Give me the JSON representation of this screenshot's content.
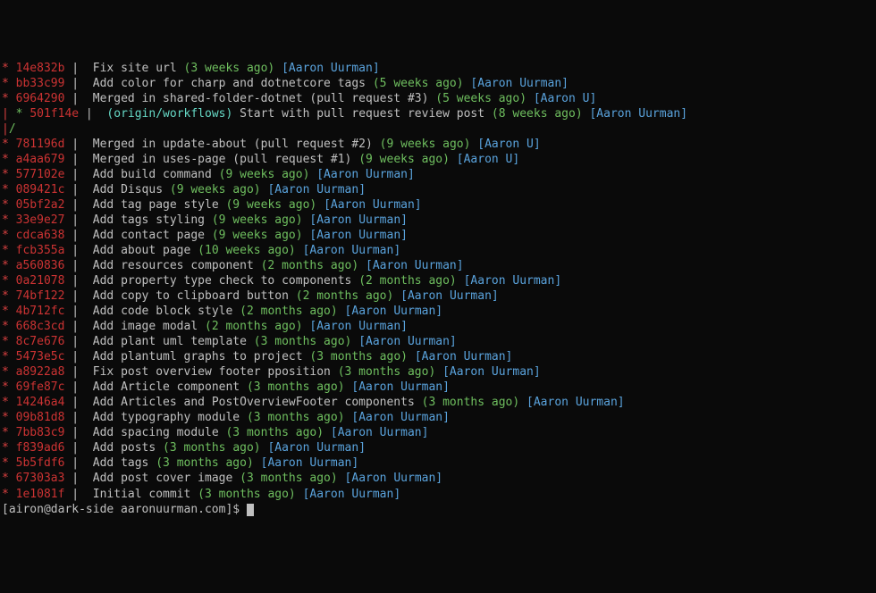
{
  "commits": [
    {
      "graph": [
        {
          "t": "*",
          "c": "red"
        }
      ],
      "hash": "14e832b",
      "msg": "Fix site url",
      "date": "(3 weeks ago)",
      "author": "[Aaron Uurman]",
      "ref": null
    },
    {
      "graph": [
        {
          "t": "*",
          "c": "red"
        }
      ],
      "hash": "bb33c99",
      "msg": "Add color for charp and dotnetcore tags",
      "date": "(5 weeks ago)",
      "author": "[Aaron Uurman]",
      "ref": null
    },
    {
      "graph": [
        {
          "t": "*",
          "c": "red"
        }
      ],
      "hash": "6964290",
      "msg": "Merged in shared-folder-dotnet (pull request #3)",
      "date": "(5 weeks ago)",
      "author": "[Aaron U]",
      "ref": null
    },
    {
      "graph": [
        {
          "t": "|",
          "c": "red"
        },
        {
          "t": " ",
          "c": ""
        },
        {
          "t": "*",
          "c": "green"
        }
      ],
      "hash": "501f14e",
      "msg": "Start with pull request review post",
      "date": "(8 weeks ago)",
      "author": "[Aaron Uurman]",
      "ref": "(origin/workflows)"
    },
    {
      "graph": [
        {
          "t": "|",
          "c": "red"
        },
        {
          "t": "/",
          "c": "green"
        }
      ],
      "graphOnly": true
    },
    {
      "graph": [
        {
          "t": "*",
          "c": "red"
        }
      ],
      "hash": "781196d",
      "msg": "Merged in update-about (pull request #2)",
      "date": "(9 weeks ago)",
      "author": "[Aaron U]",
      "ref": null
    },
    {
      "graph": [
        {
          "t": "*",
          "c": "red"
        }
      ],
      "hash": "a4aa679",
      "msg": "Merged in uses-page (pull request #1)",
      "date": "(9 weeks ago)",
      "author": "[Aaron U]",
      "ref": null
    },
    {
      "graph": [
        {
          "t": "*",
          "c": "red"
        }
      ],
      "hash": "577102e",
      "msg": "Add build command",
      "date": "(9 weeks ago)",
      "author": "[Aaron Uurman]",
      "ref": null
    },
    {
      "graph": [
        {
          "t": "*",
          "c": "red"
        }
      ],
      "hash": "089421c",
      "msg": "Add Disqus",
      "date": "(9 weeks ago)",
      "author": "[Aaron Uurman]",
      "ref": null
    },
    {
      "graph": [
        {
          "t": "*",
          "c": "red"
        }
      ],
      "hash": "05bf2a2",
      "msg": "Add tag page style",
      "date": "(9 weeks ago)",
      "author": "[Aaron Uurman]",
      "ref": null
    },
    {
      "graph": [
        {
          "t": "*",
          "c": "red"
        }
      ],
      "hash": "33e9e27",
      "msg": "Add tags styling",
      "date": "(9 weeks ago)",
      "author": "[Aaron Uurman]",
      "ref": null
    },
    {
      "graph": [
        {
          "t": "*",
          "c": "red"
        }
      ],
      "hash": "cdca638",
      "msg": "Add contact page",
      "date": "(9 weeks ago)",
      "author": "[Aaron Uurman]",
      "ref": null
    },
    {
      "graph": [
        {
          "t": "*",
          "c": "red"
        }
      ],
      "hash": "fcb355a",
      "msg": "Add about page",
      "date": "(10 weeks ago)",
      "author": "[Aaron Uurman]",
      "ref": null
    },
    {
      "graph": [
        {
          "t": "*",
          "c": "red"
        }
      ],
      "hash": "a560836",
      "msg": "Add resources component",
      "date": "(2 months ago)",
      "author": "[Aaron Uurman]",
      "ref": null
    },
    {
      "graph": [
        {
          "t": "*",
          "c": "red"
        }
      ],
      "hash": "0a21078",
      "msg": "Add property type check to components",
      "date": "(2 months ago)",
      "author": "[Aaron Uurman]",
      "ref": null
    },
    {
      "graph": [
        {
          "t": "*",
          "c": "red"
        }
      ],
      "hash": "74bf122",
      "msg": "Add copy to clipboard button",
      "date": "(2 months ago)",
      "author": "[Aaron Uurman]",
      "ref": null
    },
    {
      "graph": [
        {
          "t": "*",
          "c": "red"
        }
      ],
      "hash": "4b712fc",
      "msg": "Add code block style",
      "date": "(2 months ago)",
      "author": "[Aaron Uurman]",
      "ref": null
    },
    {
      "graph": [
        {
          "t": "*",
          "c": "red"
        }
      ],
      "hash": "668c3cd",
      "msg": "Add image modal",
      "date": "(2 months ago)",
      "author": "[Aaron Uurman]",
      "ref": null
    },
    {
      "graph": [
        {
          "t": "*",
          "c": "red"
        }
      ],
      "hash": "8c7e676",
      "msg": "Add plant uml template",
      "date": "(3 months ago)",
      "author": "[Aaron Uurman]",
      "ref": null
    },
    {
      "graph": [
        {
          "t": "*",
          "c": "red"
        }
      ],
      "hash": "5473e5c",
      "msg": "Add plantuml graphs to project",
      "date": "(3 months ago)",
      "author": "[Aaron Uurman]",
      "ref": null
    },
    {
      "graph": [
        {
          "t": "*",
          "c": "red"
        }
      ],
      "hash": "a8922a8",
      "msg": "Fix post overview footer pposition",
      "date": "(3 months ago)",
      "author": "[Aaron Uurman]",
      "ref": null
    },
    {
      "graph": [
        {
          "t": "*",
          "c": "red"
        }
      ],
      "hash": "69fe87c",
      "msg": "Add Article component",
      "date": "(3 months ago)",
      "author": "[Aaron Uurman]",
      "ref": null
    },
    {
      "graph": [
        {
          "t": "*",
          "c": "red"
        }
      ],
      "hash": "14246a4",
      "msg": "Add Articles and PostOverviewFooter components",
      "date": "(3 months ago)",
      "author": "[Aaron Uurman]",
      "ref": null
    },
    {
      "graph": [
        {
          "t": "*",
          "c": "red"
        }
      ],
      "hash": "09b81d8",
      "msg": "Add typography module",
      "date": "(3 months ago)",
      "author": "[Aaron Uurman]",
      "ref": null
    },
    {
      "graph": [
        {
          "t": "*",
          "c": "red"
        }
      ],
      "hash": "7bb83c9",
      "msg": "Add spacing module",
      "date": "(3 months ago)",
      "author": "[Aaron Uurman]",
      "ref": null
    },
    {
      "graph": [
        {
          "t": "*",
          "c": "red"
        }
      ],
      "hash": "f839ad6",
      "msg": "Add posts",
      "date": "(3 months ago)",
      "author": "[Aaron Uurman]",
      "ref": null
    },
    {
      "graph": [
        {
          "t": "*",
          "c": "red"
        }
      ],
      "hash": "5b5fdf6",
      "msg": "Add tags",
      "date": "(3 months ago)",
      "author": "[Aaron Uurman]",
      "ref": null
    },
    {
      "graph": [
        {
          "t": "*",
          "c": "red"
        }
      ],
      "hash": "67303a3",
      "msg": "Add post cover image",
      "date": "(3 months ago)",
      "author": "[Aaron Uurman]",
      "ref": null
    },
    {
      "graph": [
        {
          "t": "*",
          "c": "red"
        }
      ],
      "hash": "1e1081f",
      "msg": "Initial commit",
      "date": "(3 months ago)",
      "author": "[Aaron Uurman]",
      "ref": null
    }
  ],
  "prompt": {
    "text": "[airon@dark-side aaronuurman.com]$ "
  }
}
